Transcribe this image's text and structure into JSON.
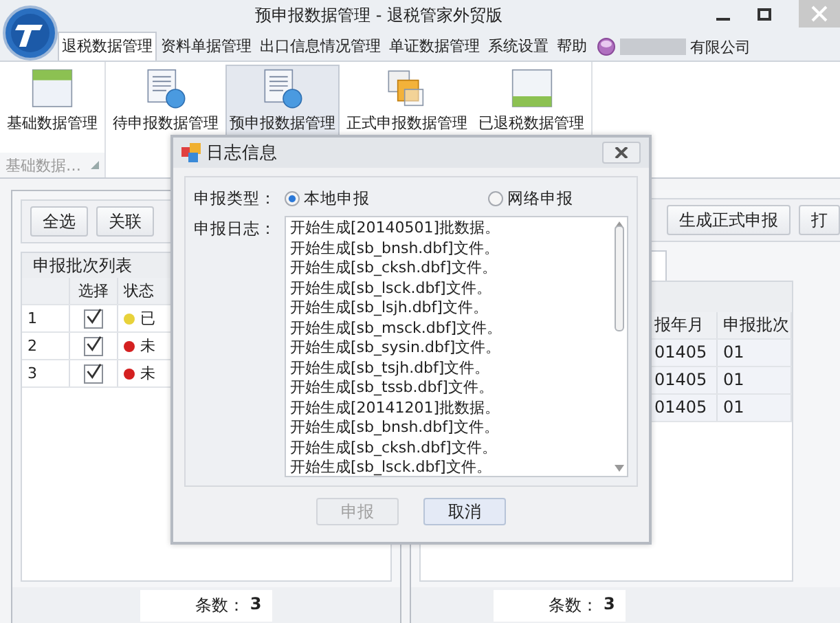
{
  "window": {
    "title": "预申报数据管理 - 退税管家外贸版"
  },
  "menu_tabs": [
    {
      "label": "退税数据管理",
      "selected": true
    },
    {
      "label": "资料单据管理",
      "selected": false
    },
    {
      "label": "出口信息情况管理",
      "selected": false
    },
    {
      "label": "单证数据管理",
      "selected": false
    },
    {
      "label": "系统设置",
      "selected": false
    },
    {
      "label": "帮助",
      "selected": false
    }
  ],
  "user": {
    "company": "有限公司"
  },
  "ribbon": {
    "groups": [
      {
        "label": "基础数据…",
        "buttons": [
          {
            "label": "基础数据管理",
            "kind": "table",
            "selected": false
          }
        ]
      },
      {
        "buttons": [
          {
            "label": "待申报数据管理",
            "kind": "doc",
            "selected": false
          },
          {
            "label": "预申报数据管理",
            "kind": "doc",
            "selected": true
          },
          {
            "label": "正式申报数据管理",
            "kind": "copy",
            "selected": false
          },
          {
            "label": "已退税数据管理",
            "kind": "done",
            "selected": false
          }
        ]
      }
    ]
  },
  "left_panel": {
    "buttons": [
      "全选",
      "关联"
    ],
    "list_title": "申报批次列表",
    "columns": [
      "选择",
      "状态"
    ],
    "rows": [
      {
        "index": "1",
        "checked": true,
        "color": "#e8d23a",
        "status": "已"
      },
      {
        "index": "2",
        "checked": true,
        "color": "#d42020",
        "status": "未"
      },
      {
        "index": "3",
        "checked": true,
        "color": "#d42020",
        "status": "未"
      }
    ],
    "count_label": "条数：",
    "count": "3"
  },
  "right_panel": {
    "buttons": [
      "生成正式申报",
      "打"
    ],
    "columns": [
      "报年月",
      "申报批次"
    ],
    "rows": [
      [
        "01405",
        "01"
      ],
      [
        "01405",
        "01"
      ],
      [
        "01405",
        "01"
      ]
    ],
    "count_label": "条数：",
    "count": "3"
  },
  "dialog": {
    "title": "日志信息",
    "type_label": "申报类型：",
    "options": [
      {
        "label": "本地申报",
        "selected": true
      },
      {
        "label": "网络申报",
        "selected": false
      }
    ],
    "log_label": "申报日志：",
    "log": [
      "开始生成[20140501]批数据。",
      "开始生成[sb_bnsh.dbf]文件。",
      "开始生成[sb_cksh.dbf]文件。",
      "开始生成[sb_lsck.dbf]文件。",
      "开始生成[sb_lsjh.dbf]文件。",
      "开始生成[sb_msck.dbf]文件。",
      "开始生成[sb_sysin.dbf]文件。",
      "开始生成[sb_tsjh.dbf]文件。",
      "开始生成[sb_tssb.dbf]文件。",
      "开始生成[20141201]批数据。",
      "开始生成[sb_bnsh.dbf]文件。",
      "开始生成[sb_cksh.dbf]文件。",
      "开始生成[sb_lsck.dbf]文件。"
    ],
    "buttons": [
      {
        "label": "申报",
        "disabled": true
      },
      {
        "label": "取消",
        "disabled": false
      }
    ]
  }
}
